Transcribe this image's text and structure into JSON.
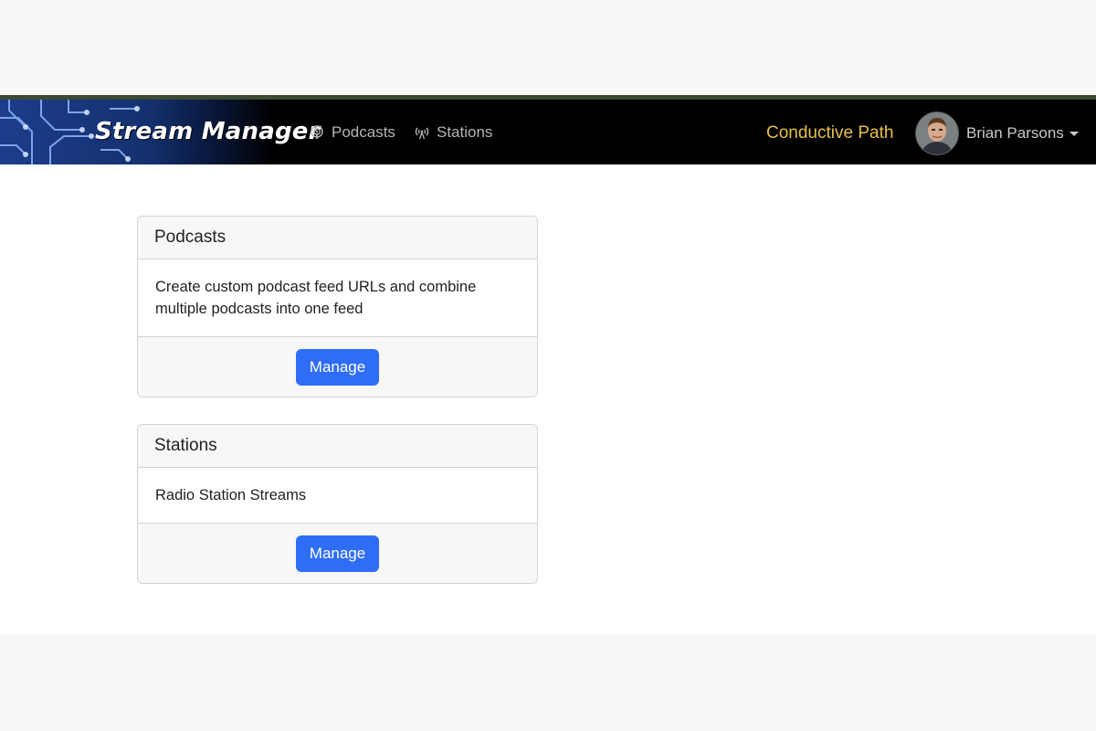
{
  "navbar": {
    "brand": "Stream Manager",
    "links": [
      {
        "label": "Podcasts",
        "icon": "podcast-icon"
      },
      {
        "label": "Stations",
        "icon": "broadcast-tower-icon"
      }
    ],
    "org_name": "Conductive Path",
    "user_name": "Brian Parsons"
  },
  "cards": [
    {
      "title": "Podcasts",
      "body": "Create custom podcast feed URLs and combine multiple podcasts into one feed",
      "button_label": "Manage"
    },
    {
      "title": "Stations",
      "body": "Radio Station Streams",
      "button_label": "Manage"
    }
  ],
  "colors": {
    "navbar_bg": "#000000",
    "org_accent": "#e5c04a",
    "button_primary": "#2f6df6"
  }
}
